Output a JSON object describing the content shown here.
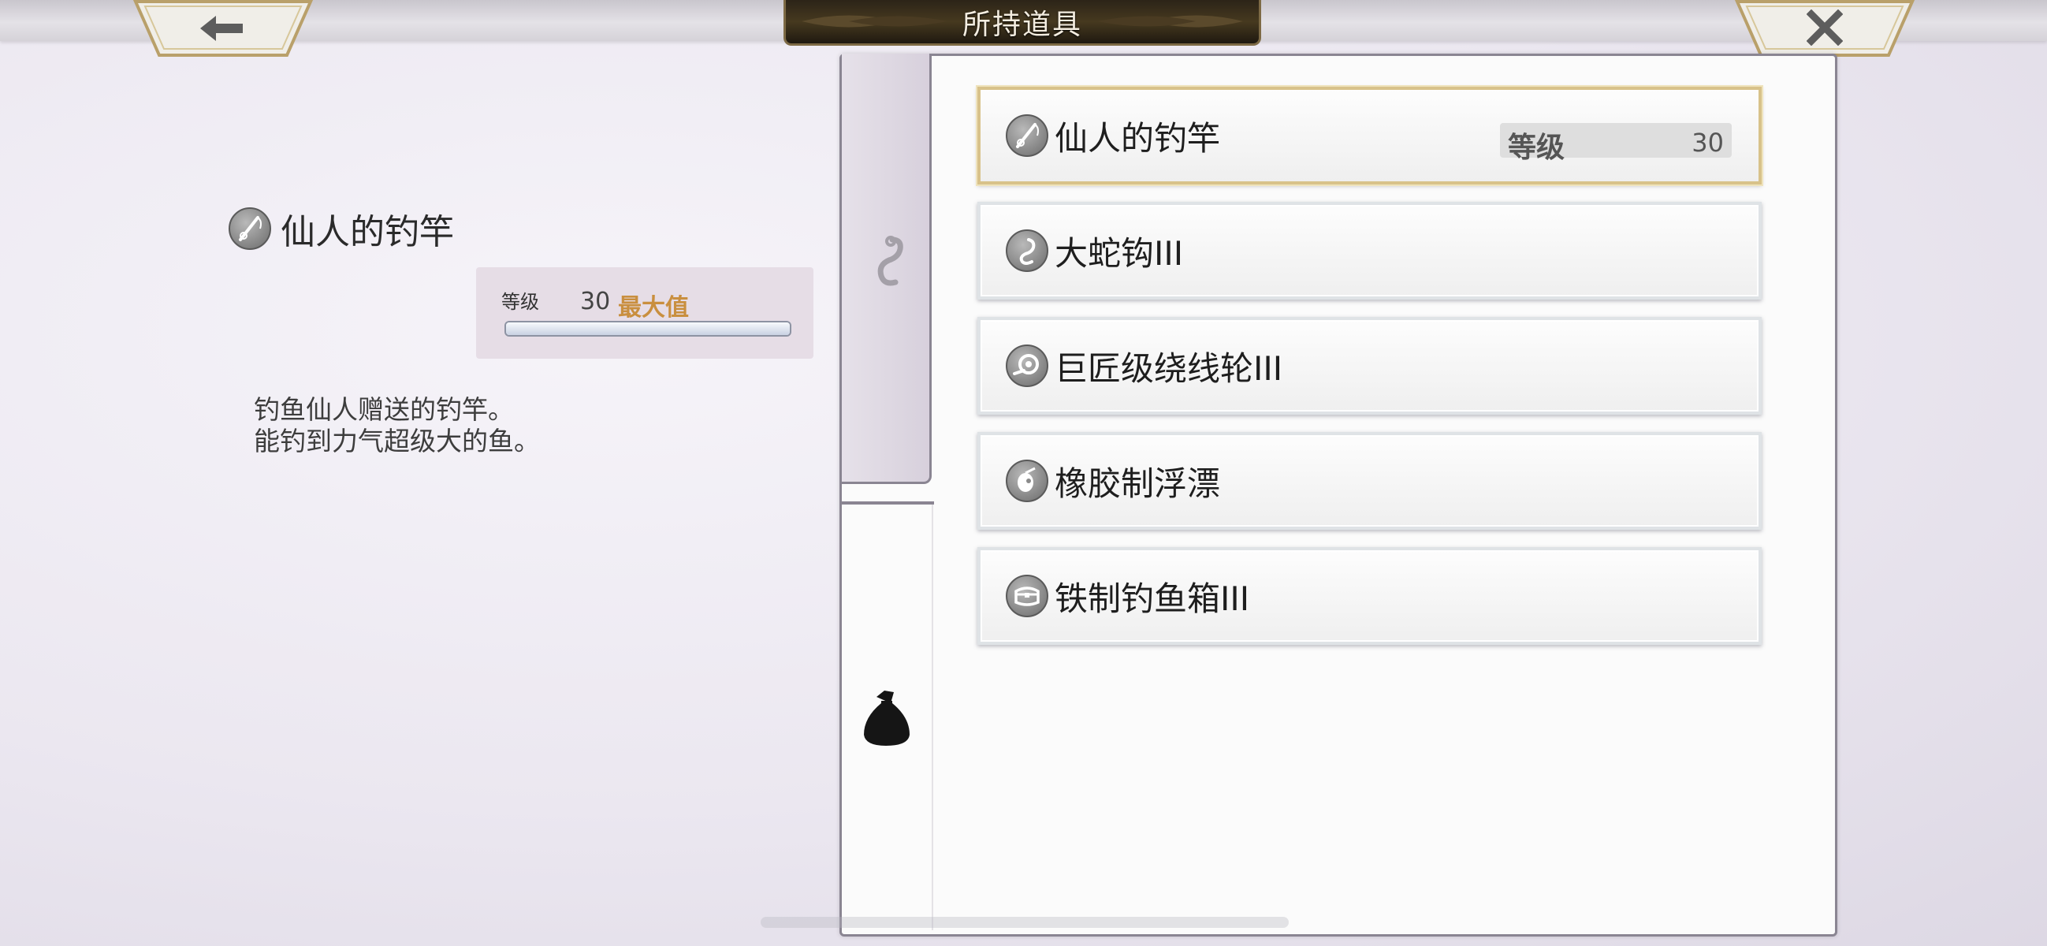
{
  "header": {
    "title": "所持道具",
    "back_icon": "arrow-left-icon",
    "close_icon": "close-x-icon"
  },
  "detail": {
    "item_name": "仙人的钓竿",
    "item_icon": "fishing-rod-icon",
    "level_label": "等级",
    "level_value": "30",
    "level_max_label": "最大值",
    "level_progress": 1.0,
    "description": [
      "钓鱼仙人赠送的钓竿。",
      "能钓到力气超级大的鱼。"
    ]
  },
  "tabs": [
    {
      "name": "hook-tab",
      "icon": "hook-icon",
      "active": true
    },
    {
      "name": "bag-tab",
      "icon": "bag-icon",
      "active": false
    }
  ],
  "items": [
    {
      "label": "仙人的钓竿",
      "icon": "fishing-rod-icon",
      "selected": true,
      "level_label": "等级",
      "level_value": "30"
    },
    {
      "label": "大蛇钩III",
      "icon": "hook-icon",
      "selected": false
    },
    {
      "label": "巨匠级绕线轮III",
      "icon": "reel-icon",
      "selected": false
    },
    {
      "label": "橡胶制浮漂",
      "icon": "float-icon",
      "selected": false
    },
    {
      "label": "铁制钓鱼箱III",
      "icon": "tackle-box-icon",
      "selected": false
    }
  ],
  "colors": {
    "accent_gold": "#d8c28a",
    "max_label": "#c98f3f",
    "title_plate": "#2c2418"
  }
}
